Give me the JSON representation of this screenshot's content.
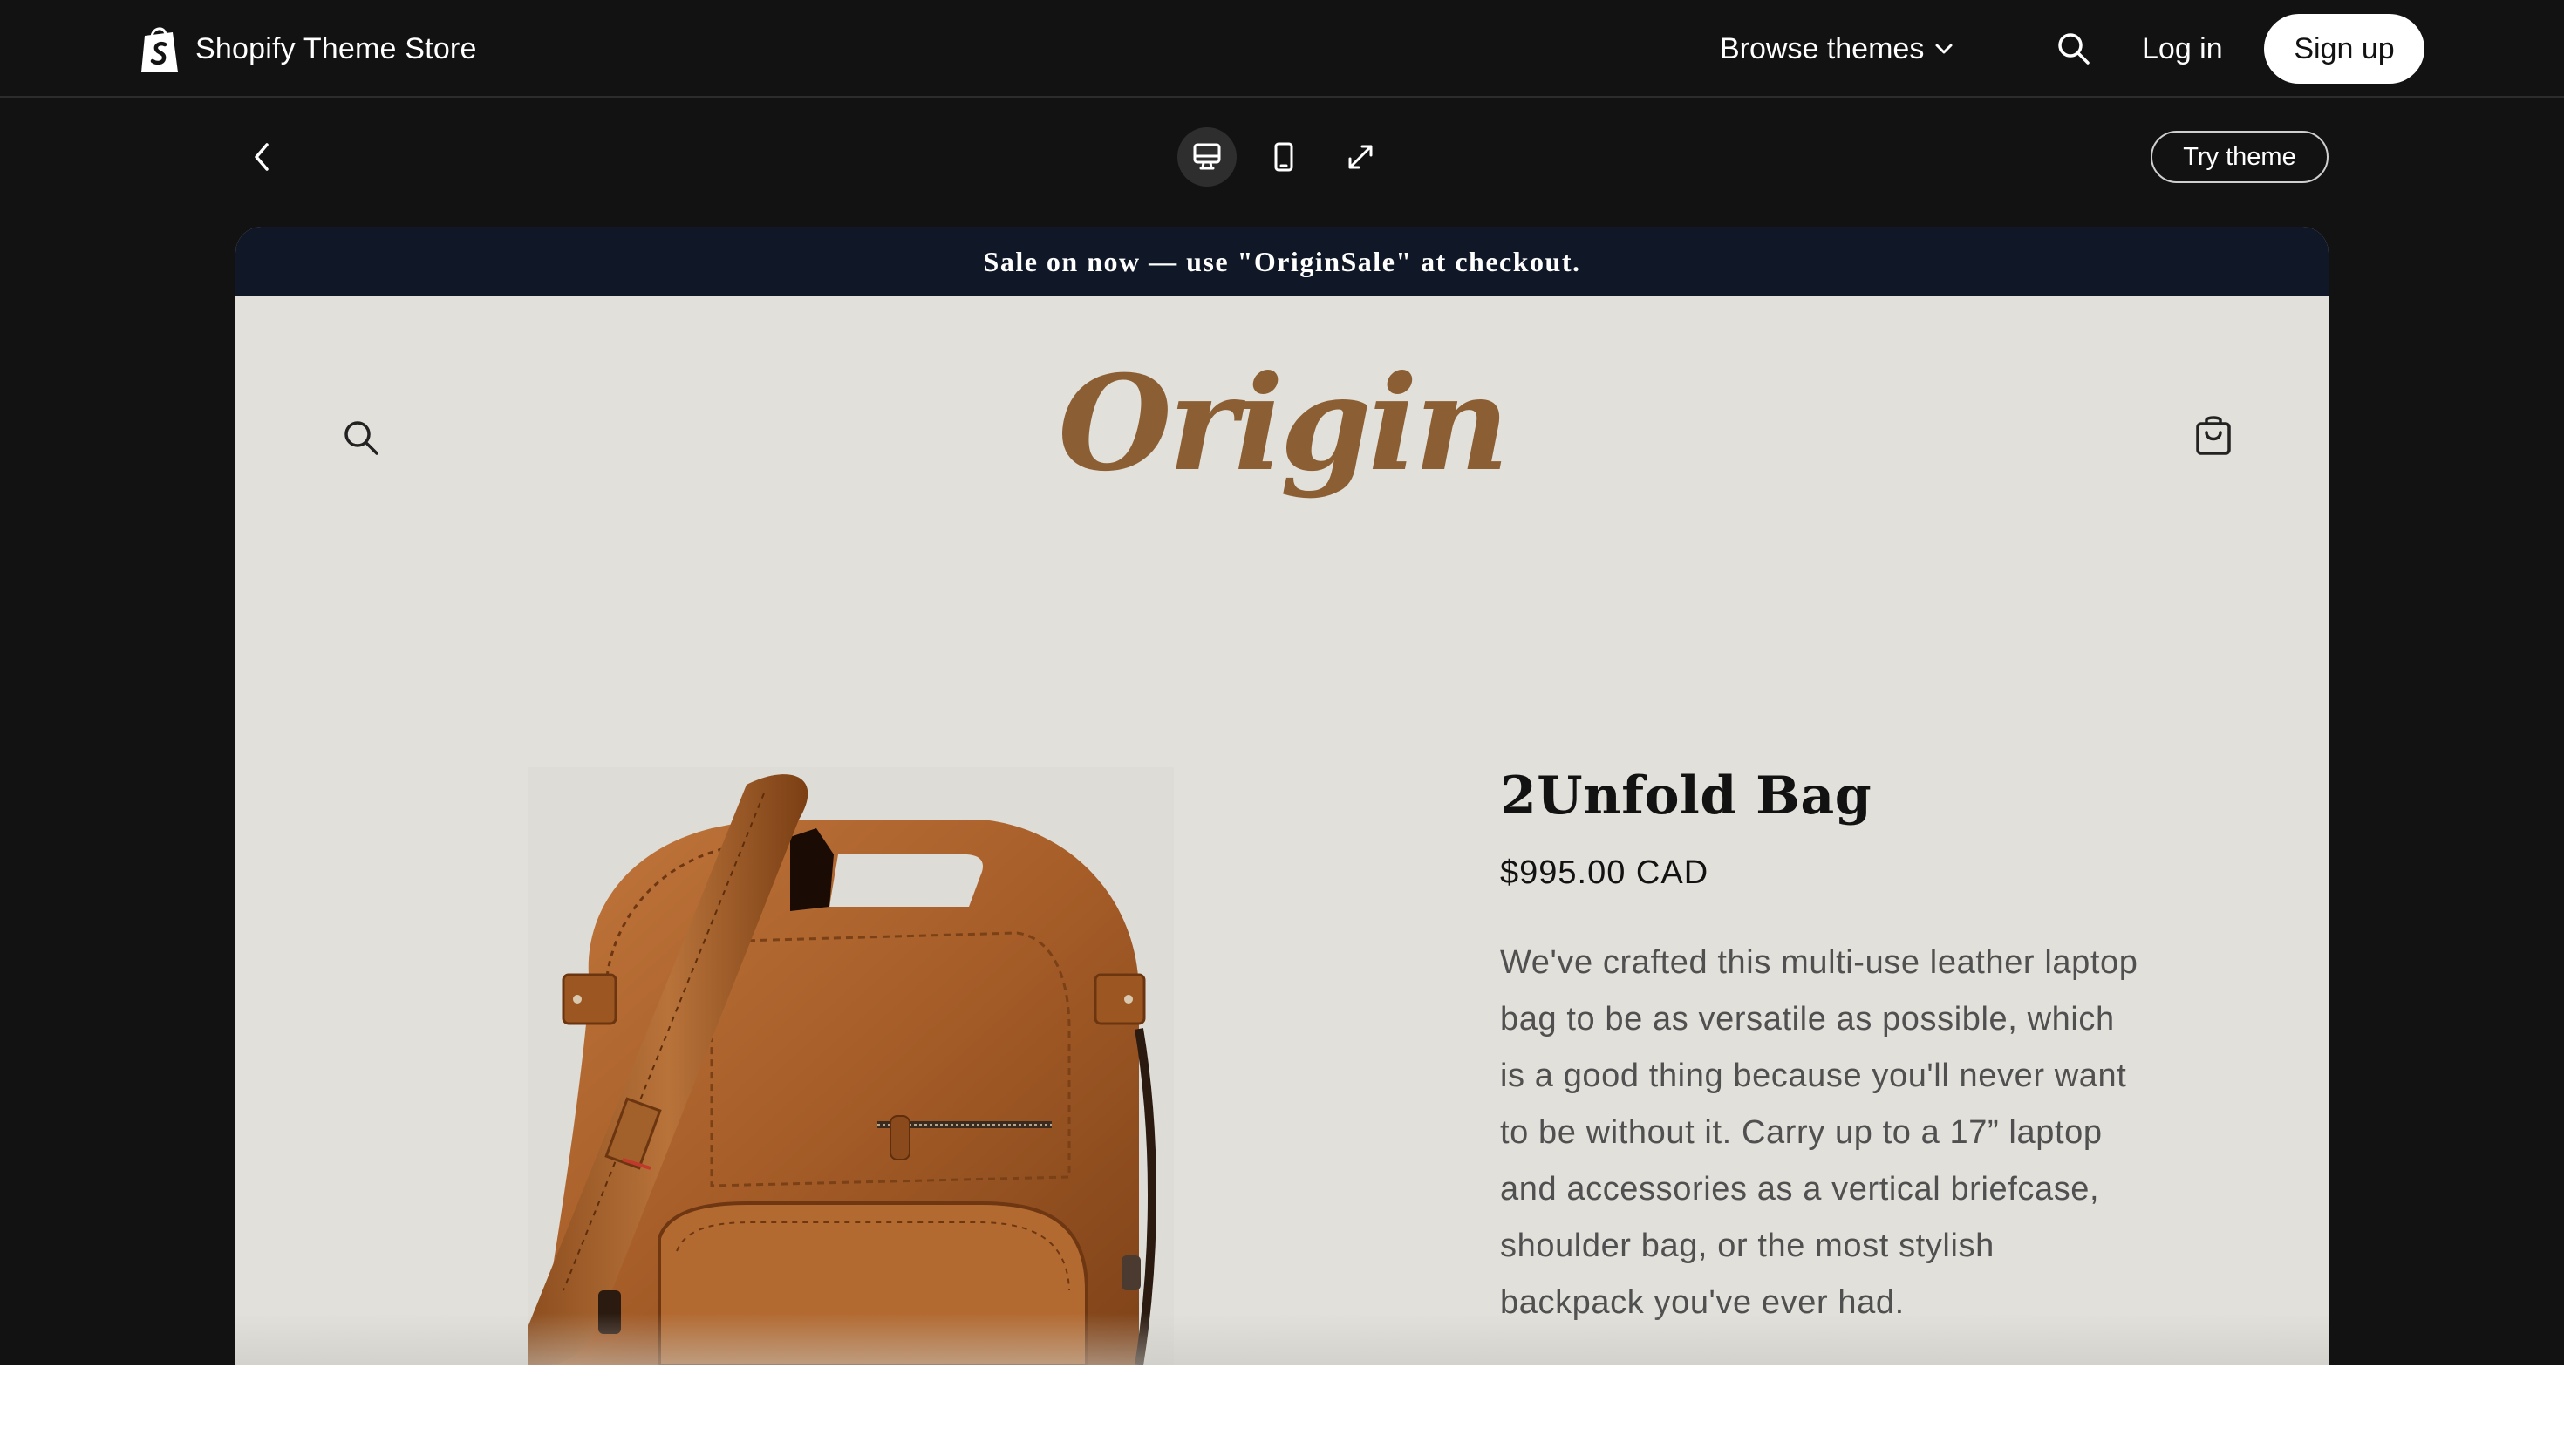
{
  "app": {
    "brand_name": "Shopify Theme Store",
    "browse_label": "Browse themes",
    "login_label": "Log in",
    "signup_label": "Sign up"
  },
  "toolbar": {
    "try_theme_label": "Try theme",
    "views": [
      "desktop-view",
      "mobile-view",
      "fullscreen"
    ],
    "active_view": "desktop-view"
  },
  "store": {
    "announcement": "Sale on now — use \"OriginSale\" at checkout.",
    "logo_text": "Origin",
    "logo_color": "#8b5f33",
    "background_color": "#e2e0da"
  },
  "product": {
    "title": "2Unfold Bag",
    "price": "$995.00 CAD",
    "description": "We've crafted this multi-use leather laptop bag to be as versatile as possible, which is a good thing because you'll never want to be without it. Carry up to a 17” laptop and accessories as a vertical briefcase, shoulder bag, or the most stylish backpack you've ever had.",
    "image": "brown-leather-bag"
  }
}
